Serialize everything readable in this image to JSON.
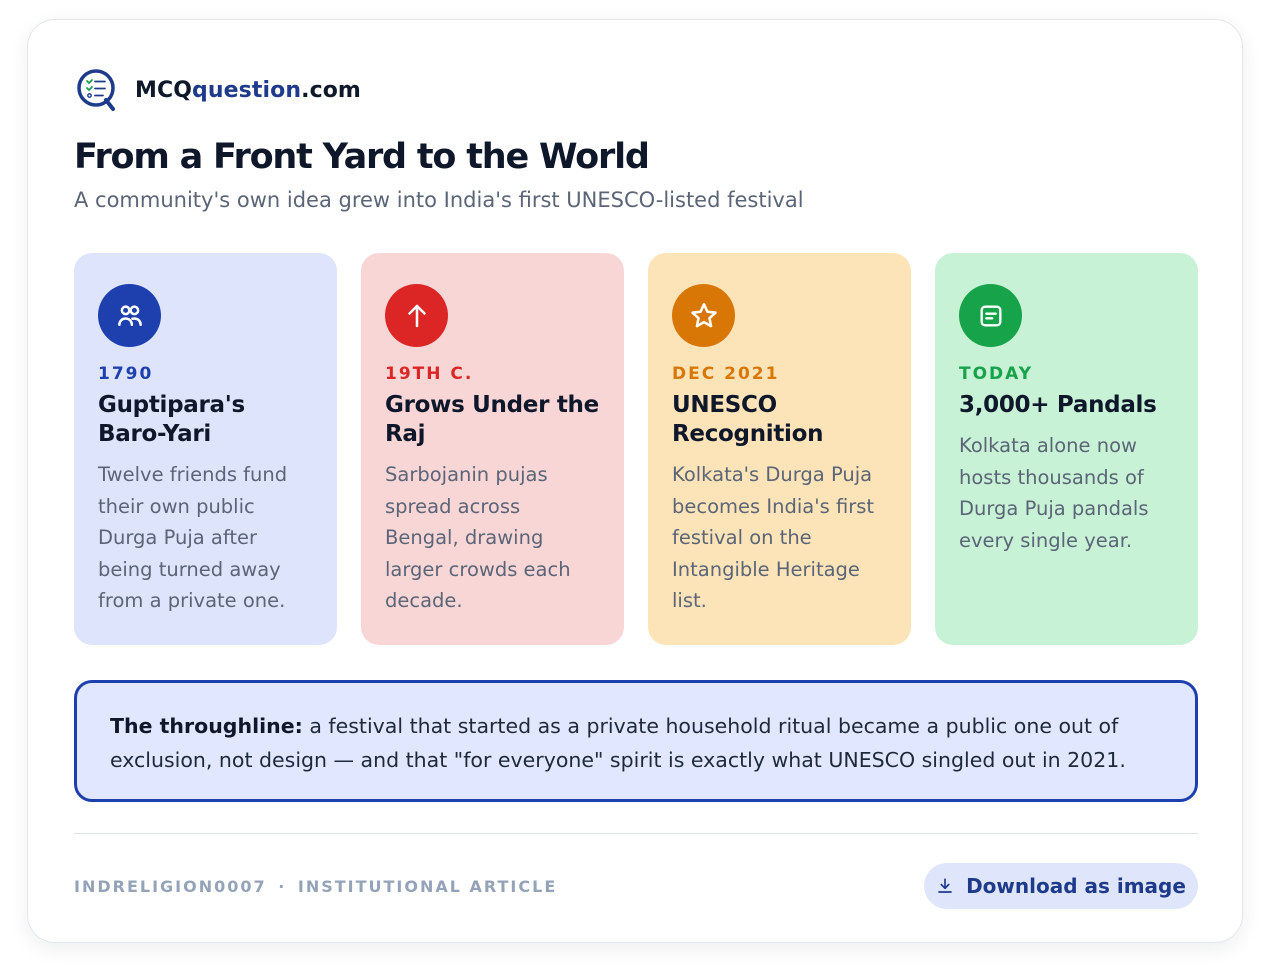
{
  "brand": {
    "name_prefix": "MCQ",
    "name_accent": "question",
    "name_suffix": ".com"
  },
  "header": {
    "title": "From a Front Yard to the World",
    "subtitle": "A community's own idea grew into India's first UNESCO-listed festival"
  },
  "tiles": [
    {
      "icon": "people-icon",
      "date": "1790",
      "title": "Guptipara's Baro-Yari",
      "description": "Twelve friends fund their own public Durga Puja after being turned away from a private one.",
      "bg_color": "#dde4fb",
      "accent_color": "#1e40af"
    },
    {
      "icon": "arrow-up-icon",
      "date": "19TH C.",
      "title": "Grows Under the Raj",
      "description": "Sarbojanin pujas spread across Bengal, drawing larger crowds each decade.",
      "bg_color": "#f9d6d6",
      "accent_color": "#dc2626"
    },
    {
      "icon": "star-icon",
      "date": "DEC 2021",
      "title": "UNESCO Recognition",
      "description": "Kolkata's Durga Puja becomes India's first festival on the Intangible Heritage list.",
      "bg_color": "#fde4b8",
      "accent_color": "#d97706"
    },
    {
      "icon": "document-icon",
      "date": "TODAY",
      "title": "3,000+ Pandals",
      "description": "Kolkata alone now hosts thousands of Durga Puja pandals every single year.",
      "bg_color": "#c8f2d6",
      "accent_color": "#16a34a"
    }
  ],
  "note": {
    "lead": "The throughline:",
    "body": " a festival that started as a private household ritual became a public one out of exclusion, not design — and that \"for everyone\" spirit is exactly what UNESCO singled out in 2021."
  },
  "footer": {
    "code": "INDRELIGION0007",
    "separator": "·",
    "category": "INSTITUTIONAL ARTICLE",
    "download_label": "Download as image"
  },
  "colors": {
    "brand_accent": "#1e3a8a",
    "note_border": "#1e40af",
    "note_bg": "#e0e7ff",
    "button_bg": "#dfe6fb"
  }
}
